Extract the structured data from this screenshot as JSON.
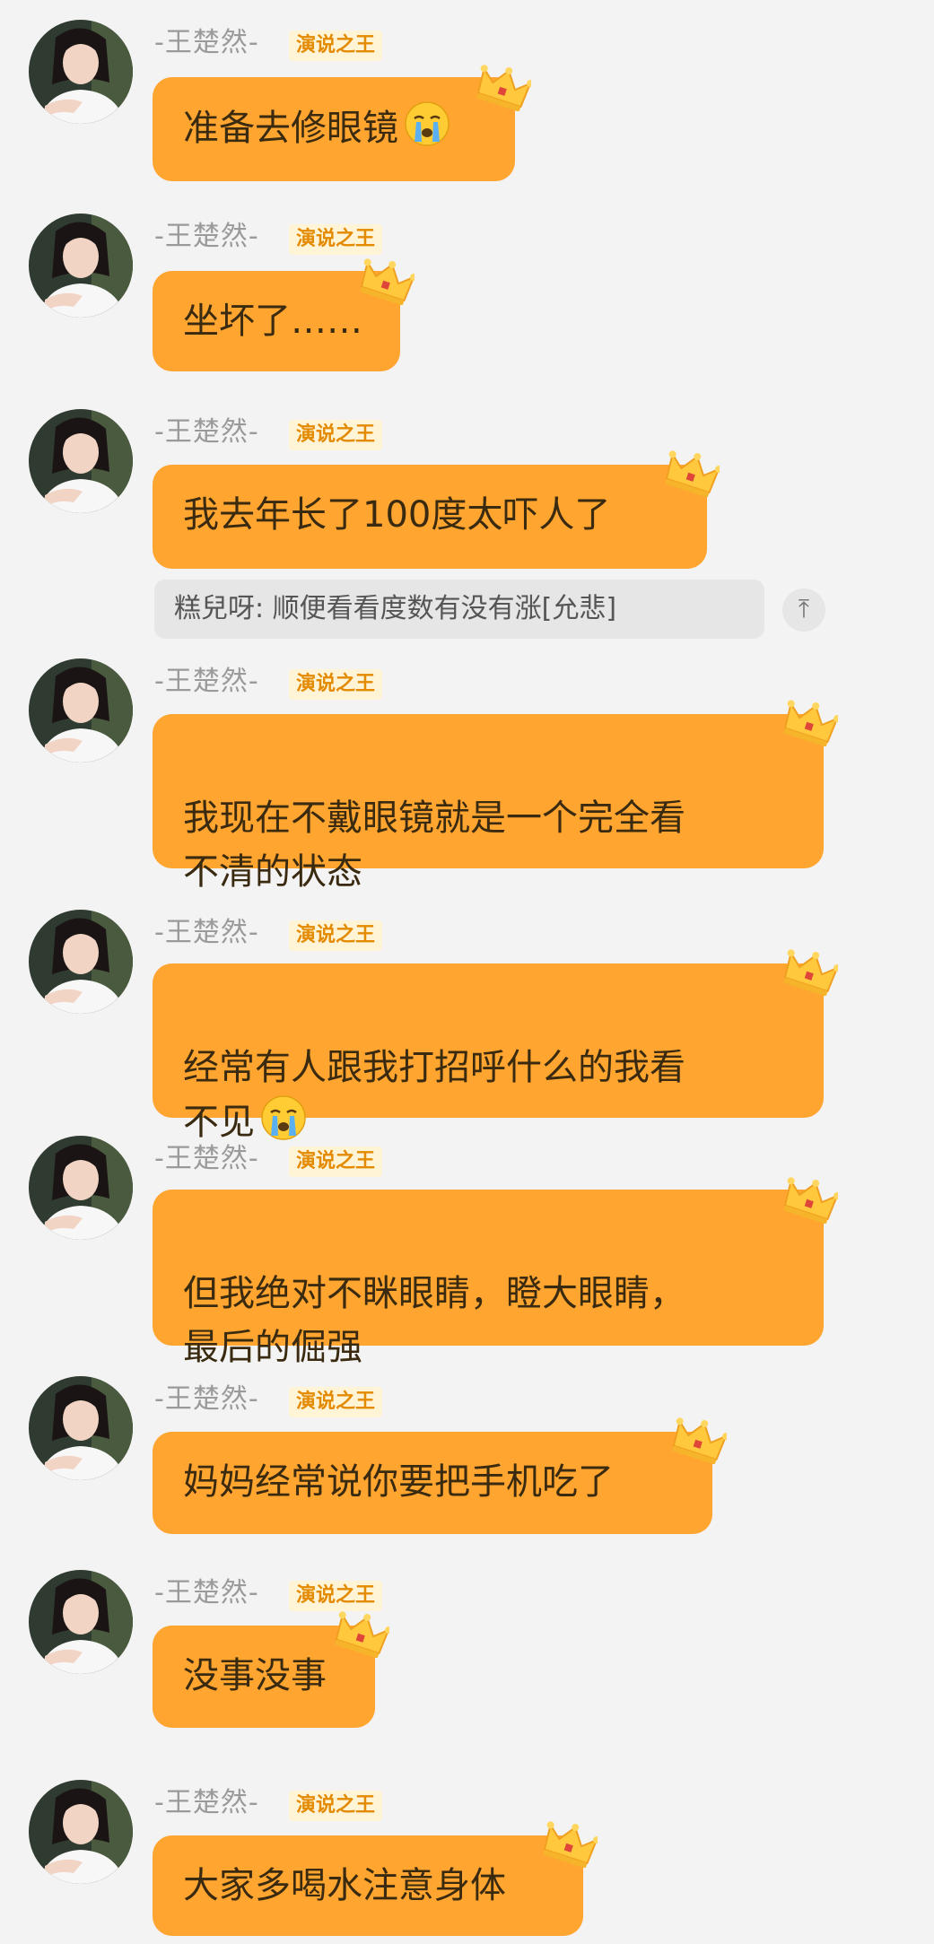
{
  "sender": {
    "name": "-王楚然-",
    "badge": "演说之王"
  },
  "messages": [
    {
      "text": "准备去修眼镜",
      "emoji": "crying-face"
    },
    {
      "text": "坐坏了……"
    },
    {
      "text": "我去年长了100度太吓人了"
    },
    {
      "text": "我现在不戴眼镜就是一个完全看\n不清的状态"
    },
    {
      "text": "经常有人跟我打招呼什么的我看\n不见",
      "emoji": "crying-face"
    },
    {
      "text": "但我绝对不眯眼睛，瞪大眼睛，\n最后的倔强"
    },
    {
      "text": "妈妈经常说你要把手机吃了"
    },
    {
      "text": "没事没事"
    },
    {
      "text": "大家多喝水注意身体"
    }
  ],
  "quote": {
    "text": "糕兒呀: 顺便看看度数有没有涨[允悲]",
    "arrow_icon": "arrow-up-icon",
    "arrow_glyph": "⤒"
  },
  "colors": {
    "bubble": "#ffa530",
    "badge_text": "#e38a00",
    "crown": "#ffc83d"
  }
}
